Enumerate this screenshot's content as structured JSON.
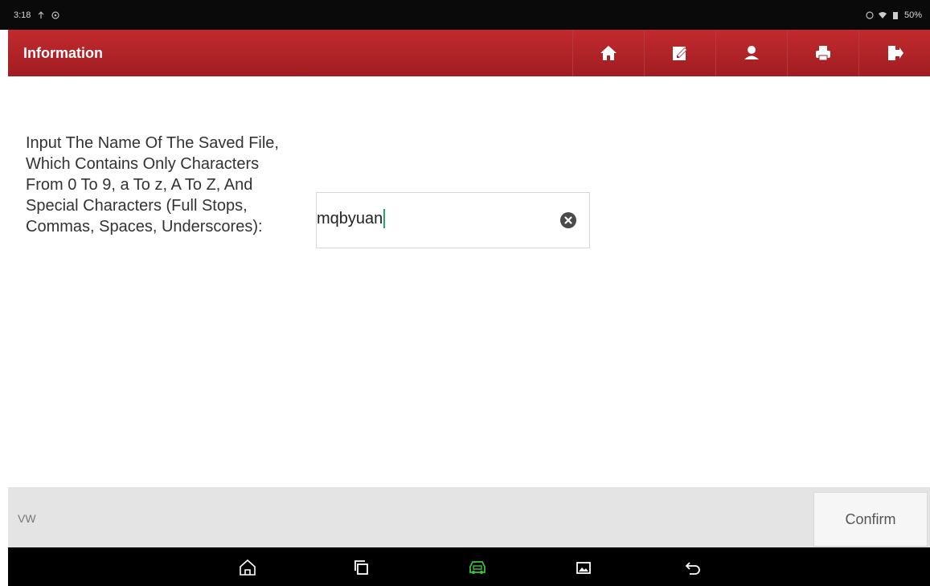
{
  "status_bar": {
    "time": "3:18",
    "battery": "50%"
  },
  "header": {
    "title": "Information",
    "toolbar_icons": [
      "home-icon",
      "edit-report-icon",
      "user-icon",
      "print-icon",
      "exit-icon"
    ]
  },
  "form": {
    "prompt": "Input The Name Of The Saved File, Which Contains Only Characters From 0 To 9, a To z, A To Z, And Special Characters (Full Stops, Commas, Spaces, Underscores):",
    "input_value": "mqbyuan"
  },
  "footer": {
    "vehicle_label": "VW",
    "confirm_label": "Confirm"
  },
  "nav_bar": {
    "icons": [
      "home-outline-icon",
      "recent-apps-icon",
      "car-diagnostic-icon",
      "screenshot-icon",
      "back-icon"
    ]
  },
  "colors": {
    "header_red": "#b22327",
    "caret_green": "#1faa6a",
    "nav_green": "#3cc23c"
  }
}
